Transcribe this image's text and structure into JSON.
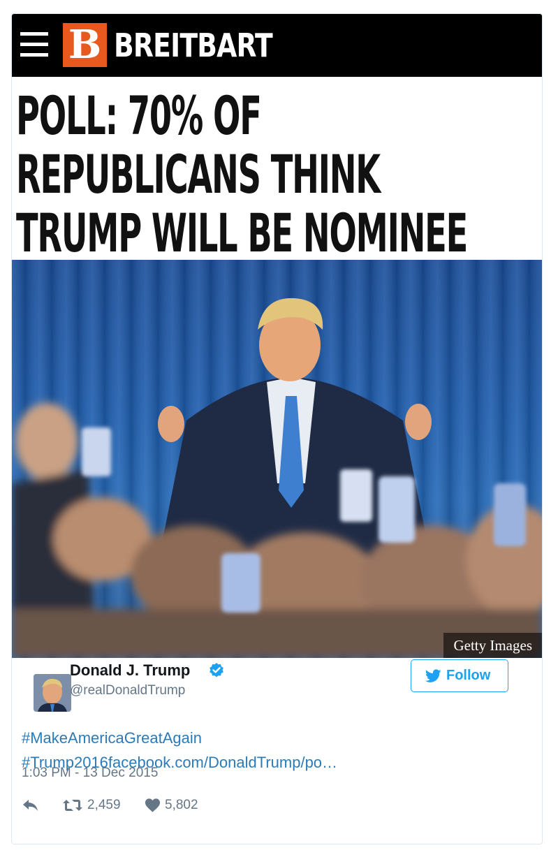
{
  "article": {
    "site_logo_letter": "B",
    "site_name": "BREITBART",
    "headline_lines": [
      "POLL: 70% OF",
      "REPUBLICANS THINK",
      "TRUMP WILL BE NOMINEE"
    ],
    "photo_credit": "Getty Images",
    "colors": {
      "navbar": "#000000",
      "logo_bg": "#e8591f",
      "curtain": "#1f5fb0"
    }
  },
  "tweet": {
    "author_name": "Donald J. Trump",
    "handle": "@realDonaldTrump",
    "verified_icon": "verified-badge-icon",
    "follow_label": "Follow",
    "text_lines": [
      "#MakeAmericaGreatAgain",
      "#Trump2016facebook.com/DonaldTrump/po…"
    ],
    "timestamp": "1:03 PM - 13 Dec 2015",
    "retweets": "2,459",
    "likes": "5,802",
    "colors": {
      "link": "#2b7bb9",
      "accent": "#1da1f2",
      "muted": "#657786"
    }
  }
}
